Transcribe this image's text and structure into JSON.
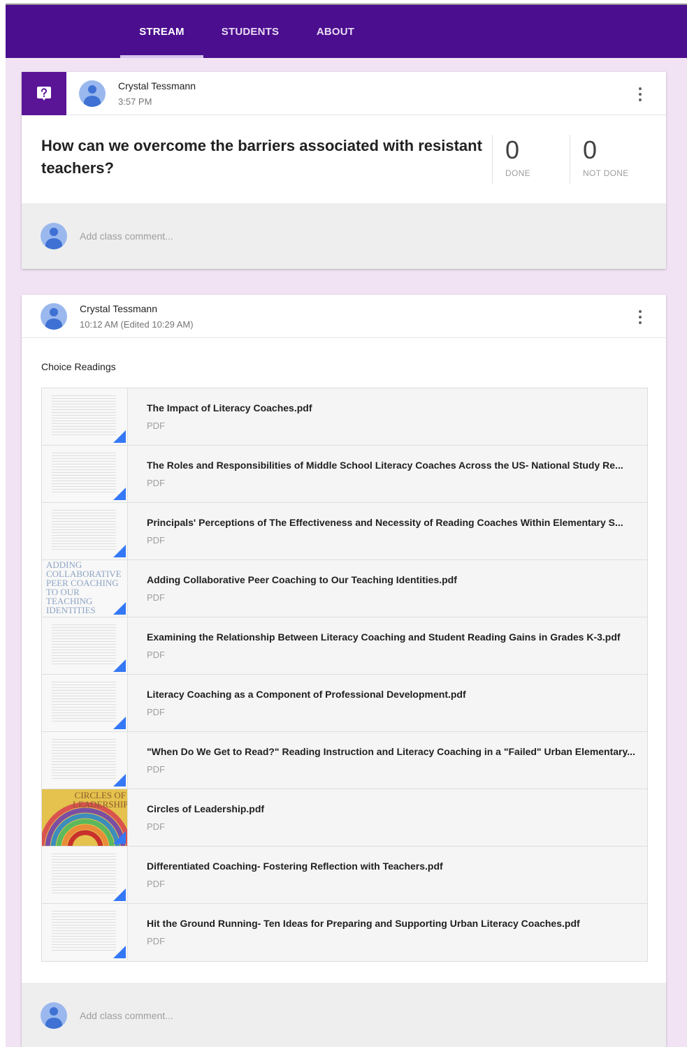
{
  "nav": {
    "tabs": [
      {
        "label": "STREAM",
        "active": true
      },
      {
        "label": "STUDENTS",
        "active": false
      },
      {
        "label": "ABOUT",
        "active": false
      }
    ]
  },
  "colors": {
    "header": "#4b0e8e",
    "background": "#f1e3f4",
    "question_badge": "#5a1496",
    "attachment_corner": "#3478f6"
  },
  "question_post": {
    "author": "Crystal Tessmann",
    "time": "3:57 PM",
    "question": "How can we overcome the barriers associated with resistant teachers?",
    "done_count": "0",
    "done_label": "DONE",
    "not_done_count": "0",
    "not_done_label": "NOT DONE",
    "comment_placeholder": "Add class comment..."
  },
  "material_post": {
    "author": "Crystal Tessmann",
    "time": "10:12 AM (Edited 10:29 AM)",
    "title": "Choice Readings",
    "comment_placeholder": "Add class comment...",
    "attachments": [
      {
        "title": "The Impact of Literacy Coaches.pdf",
        "type": "PDF",
        "thumb_text": ""
      },
      {
        "title": "The Roles and Responsibilities of Middle School Literacy Coaches Across the US- National Study Re...",
        "type": "PDF",
        "thumb_text": ""
      },
      {
        "title": "Principals' Perceptions of The Effectiveness and Necessity of Reading Coaches Within Elementary S...",
        "type": "PDF",
        "thumb_text": ""
      },
      {
        "title": "Adding Collaborative Peer Coaching to Our Teaching Identities.pdf",
        "type": "PDF",
        "thumb_text": "Adding Collaborative Peer Coaching to our Teaching Identities"
      },
      {
        "title": "Examining the Relationship Between Literacy Coaching and Student Reading Gains in Grades K-3.pdf",
        "type": "PDF",
        "thumb_text": ""
      },
      {
        "title": "Literacy Coaching as a Component of Professional Development.pdf",
        "type": "PDF",
        "thumb_text": ""
      },
      {
        "title": "\"When Do We Get to Read?\" Reading Instruction and Literacy Coaching in a \"Failed\" Urban Elementary...",
        "type": "PDF",
        "thumb_text": ""
      },
      {
        "title": "Circles of Leadership.pdf",
        "type": "PDF",
        "thumb_text": "Circles of Leadership"
      },
      {
        "title": "Differentiated Coaching- Fostering Reflection with Teachers.pdf",
        "type": "PDF",
        "thumb_text": ""
      },
      {
        "title": "Hit the Ground Running- Ten Ideas for Preparing and Supporting Urban Literacy Coaches.pdf",
        "type": "PDF",
        "thumb_text": ""
      }
    ]
  }
}
